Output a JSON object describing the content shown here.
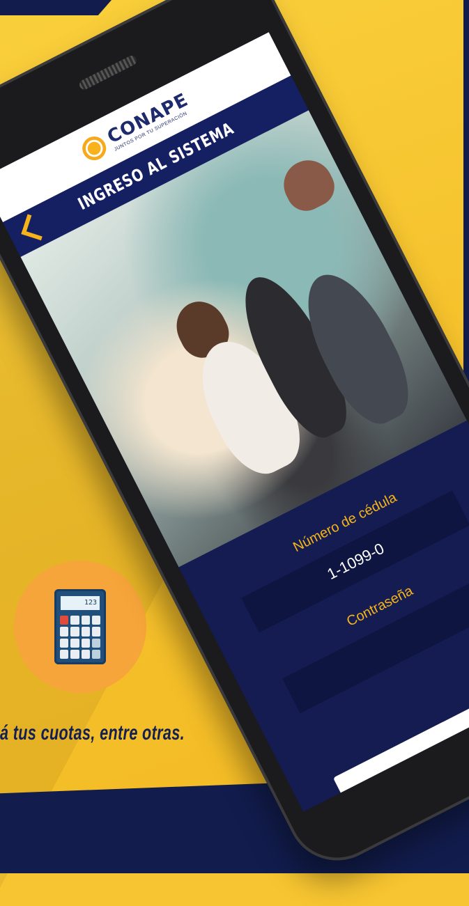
{
  "tagline": "á tus cuotas, entre otras.",
  "app": {
    "logo_name": "CONAPE",
    "logo_slogan": "JUNTOS POR TU SUPERACIÓN",
    "screen_title": "INGRESO AL SISTEMA",
    "cedula_label": "Número de cédula",
    "cedula_value": "1-1099-0",
    "password_label": "Contraseña"
  },
  "calculator_display": "123",
  "colors": {
    "navy": "#121d4e",
    "yellow": "#f7c531",
    "orange": "#f6a53a",
    "accent": "#f4b41a"
  }
}
